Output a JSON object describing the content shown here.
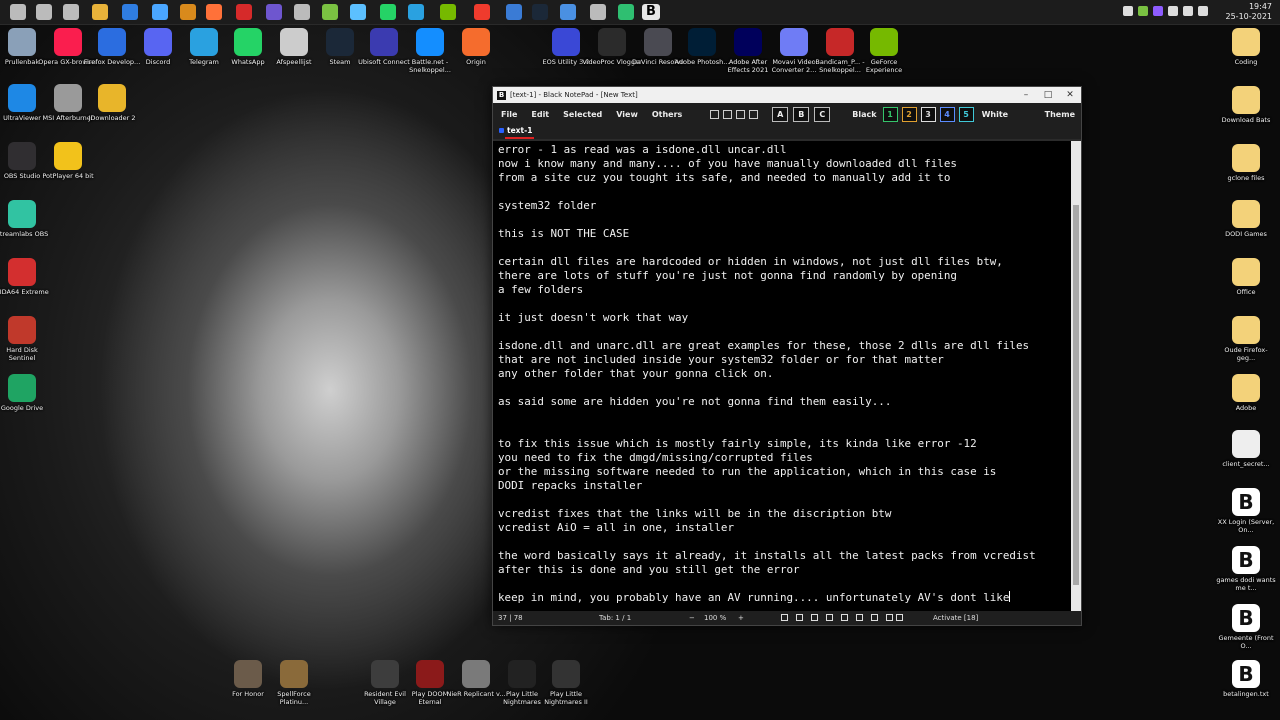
{
  "taskbar": {
    "active_app_letter": "B",
    "clock_time": "19:47",
    "clock_date": "25-10-2021",
    "icon_colors": [
      "#bbbbbb",
      "#bbbbbb",
      "#bbbbbb",
      "#e8b23a",
      "#2f7de1",
      "#4aa6ff",
      "#d98a1c",
      "#ff7139",
      "#d62a2a",
      "#6e56cf",
      "#bbbbbb",
      "#7ac142",
      "#5cc0ff",
      "#25d366",
      "#2aa1e0",
      "#76b900",
      "#ef3b2d",
      "#3a7bd5",
      "#1b2838",
      "#4a90e2",
      "#bbbbbb",
      "#2fbf71"
    ]
  },
  "desktop_left": [
    {
      "label": "Prullenbak",
      "icon": "recycle-bin-icon",
      "color": "#8aa0b8"
    },
    {
      "label": "Opera GX-browser",
      "icon": "opera-gx-icon",
      "color": "#fa1e4e"
    },
    {
      "label": "Firefox Develop...",
      "icon": "firefox-icon",
      "color": "#2b6de0"
    },
    {
      "label": "Discord",
      "icon": "discord-icon",
      "color": "#5865f2"
    },
    {
      "label": "Telegram",
      "icon": "telegram-icon",
      "color": "#2aa1e0"
    },
    {
      "label": "WhatsApp",
      "icon": "whatsapp-icon",
      "color": "#25d366"
    },
    {
      "label": "Afspeellijst",
      "icon": "playlist-icon",
      "color": "#cccccc"
    },
    {
      "label": "Steam",
      "icon": "steam-icon",
      "color": "#1b2838"
    },
    {
      "label": "Ubisoft Connect",
      "icon": "ubisoft-icon",
      "color": "#3b3bb0"
    },
    {
      "label": "Battle.net - Snelkoppel...",
      "icon": "battlenet-icon",
      "color": "#148eff"
    },
    {
      "label": "Origin",
      "icon": "origin-icon",
      "color": "#f56c2d"
    },
    {
      "label": "UltraViewer",
      "icon": "ultraviewer-icon",
      "color": "#1e88e5"
    },
    {
      "label": "MSI Afterburner",
      "icon": "msi-afterburner-icon",
      "color": "#9a9a9a"
    },
    {
      "label": "JDownloader 2",
      "icon": "jdownloader-icon",
      "color": "#e8b52a"
    },
    {
      "label": "OBS Studio",
      "icon": "obs-icon",
      "color": "#302e31"
    },
    {
      "label": "PotPlayer 64 bit",
      "icon": "potplayer-icon",
      "color": "#f2c21b"
    },
    {
      "label": "Streamlabs OBS",
      "icon": "streamlabs-icon",
      "color": "#31c3a2"
    },
    {
      "label": "AIDA64 Extreme",
      "icon": "aida64-icon",
      "color": "#d32f2f"
    },
    {
      "label": "Hard Disk Sentinel",
      "icon": "hard-disk-sentinel-icon",
      "color": "#c0392b"
    },
    {
      "label": "Google Drive",
      "icon": "google-drive-icon",
      "color": "#1fa463"
    }
  ],
  "desktop_top": [
    {
      "label": "EOS Utility 3.0",
      "icon": "eos-utility-icon",
      "color": "#3a48d6"
    },
    {
      "label": "VideoProc Vlogger",
      "icon": "videoproc-icon",
      "color": "#2b2b2b"
    },
    {
      "label": "DaVinci Resolve",
      "icon": "davinci-resolve-icon",
      "color": "#4a4a52"
    },
    {
      "label": "Adobe Photosh...",
      "icon": "photoshop-icon",
      "color": "#001e36"
    },
    {
      "label": "Adobe After Effects 2021",
      "icon": "after-effects-icon",
      "color": "#00005b"
    },
    {
      "label": "Movavi Video Converter 2...",
      "icon": "movavi-icon",
      "color": "#6f7cf5"
    },
    {
      "label": "Bandicam_P... - Snelkoppel...",
      "icon": "bandicam-icon",
      "color": "#c62828"
    },
    {
      "label": "GeForce Experience",
      "icon": "geforce-icon",
      "color": "#76b900"
    }
  ],
  "desktop_right": [
    {
      "label": "Coding",
      "icon": "folder-b-icon",
      "color": "#f3d27a"
    },
    {
      "label": "Download Bats",
      "icon": "folder-icon",
      "color": "#f3d27a"
    },
    {
      "label": "gclone files",
      "icon": "folder-icon",
      "color": "#f3d27a"
    },
    {
      "label": "DODI Games",
      "icon": "folder-icon",
      "color": "#f3d27a"
    },
    {
      "label": "Office",
      "icon": "folder-icon",
      "color": "#f3d27a"
    },
    {
      "label": "Oude Firefox-geg...",
      "icon": "folder-icon",
      "color": "#f3d27a"
    },
    {
      "label": "Adobe",
      "icon": "folder-icon",
      "color": "#f3d27a"
    },
    {
      "label": "client_secret...",
      "icon": "json-file-icon",
      "color": "#eeeeee"
    },
    {
      "label": "XX Login (Server, On...",
      "icon": "black-notepad-file-icon",
      "color": "#111111"
    },
    {
      "label": "games dodi wants me t...",
      "icon": "black-notepad-file-icon",
      "color": "#111111"
    },
    {
      "label": "Gemeente (Front O...",
      "icon": "black-notepad-file-icon",
      "color": "#111111"
    },
    {
      "label": "betalingen.txt",
      "icon": "black-notepad-file-icon",
      "color": "#111111"
    }
  ],
  "desktop_bottom": [
    {
      "label": "For Honor",
      "icon": "for-honor-icon",
      "color": "#6b5b4a"
    },
    {
      "label": "SpellForce Platinu...",
      "icon": "spellforce-icon",
      "color": "#8a6a3a"
    },
    {
      "label": "Resident Evil Village",
      "icon": "resident-evil-icon",
      "color": "#3d3d3d"
    },
    {
      "label": "Play DOOM Eternal",
      "icon": "doom-icon",
      "color": "#8b1a1a"
    },
    {
      "label": "NieR Replicant v...",
      "icon": "nier-icon",
      "color": "#7a7a7a"
    },
    {
      "label": "Play Little Nightmares",
      "icon": "little-nightmares-icon",
      "color": "#222222"
    },
    {
      "label": "Play Little Nightmares II",
      "icon": "little-nightmares-2-icon",
      "color": "#333333"
    }
  ],
  "notepad": {
    "title": "[text-1] - Black NotePad - [New Text]",
    "menu": [
      "File",
      "Edit",
      "Selected",
      "View",
      "Others"
    ],
    "format_buttons": [
      "A",
      "B",
      "C"
    ],
    "black_label": "Black",
    "numbers": [
      "1",
      "2",
      "3",
      "4",
      "5"
    ],
    "number_colors": [
      "#35c46a",
      "#e0a030",
      "#dddddd",
      "#5b8cff",
      "#40c8d8"
    ],
    "white_label": "White",
    "theme_label": "Theme",
    "tab": "text-1",
    "lines": [
      "error - 1 as read was a isdone.dll uncar.dll",
      "now i know many and many.... of you have manually downloaded dll files",
      "from a site cuz you tought its safe, and needed to manually add it to",
      "",
      "system32 folder",
      "",
      "this is NOT THE CASE",
      "",
      "certain dll files are hardcoded or hidden in windows, not just dll files btw,",
      "there are lots of stuff you're just not gonna find randomly by opening",
      "a few folders",
      "",
      "it just doesn't work that way",
      "",
      "isdone.dll and unarc.dll are great examples for these, those 2 dlls are dll files",
      "that are not included inside your system32 folder or for that matter",
      "any other folder that your gonna click on.",
      "",
      "as said some are hidden you're not gonna find them easily...",
      "",
      "",
      "to fix this issue which is mostly fairly simple, its kinda like error -12",
      "you need to fix the dmgd/missing/corrupted files",
      "or the missing software needed to run the application, which in this case is",
      "DODI repacks installer",
      "",
      "vcredist fixes that the links will be in the discription btw",
      "vcredist AiO = all in one, installer",
      "",
      "the word basically says it already, it installs all the latest packs from vcredist",
      "after this is done and you still get the error",
      "",
      "keep in mind, you probably have an AV running.... unfortunately AV's dont like"
    ],
    "status": {
      "position": "37 | 78",
      "tab": "Tab: 1 / 1",
      "zoom_minus": "−",
      "zoom": "100 %",
      "zoom_plus": "+",
      "activate": "Activate [18]"
    }
  }
}
